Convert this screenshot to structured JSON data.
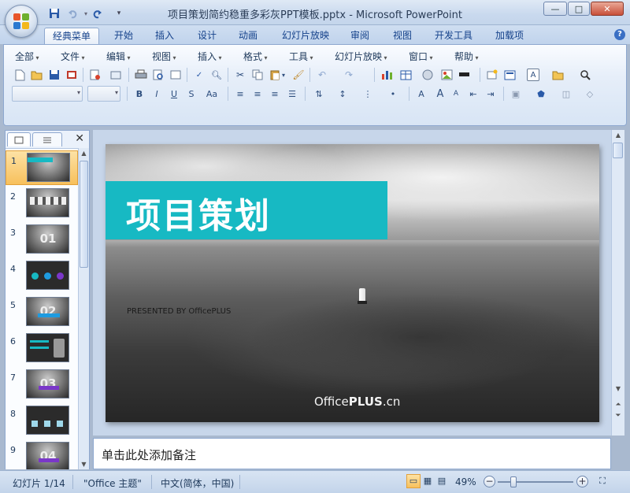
{
  "window": {
    "title": "项目策划简约稳重多彩灰PPT模板.pptx - Microsoft PowerPoint",
    "minimize": "—",
    "maximize": "□",
    "close": "✕"
  },
  "quick_access": {
    "save_icon": "save-icon",
    "undo_icon": "undo-icon",
    "redo_icon": "redo-icon",
    "customize": "▾"
  },
  "ribbon_tabs": [
    "经典菜单",
    "开始",
    "插入",
    "设计",
    "动画",
    "幻灯片放映",
    "审阅",
    "视图",
    "开发工具",
    "加载项"
  ],
  "active_tab": "经典菜单",
  "classic_menu": [
    "全部",
    "文件",
    "编辑",
    "视图",
    "插入",
    "格式",
    "工具",
    "幻灯片放映",
    "窗口",
    "帮助"
  ],
  "format_toolbar": {
    "bold": "B",
    "italic": "I",
    "underline": "U",
    "strikethrough": "S",
    "change_case": "Aa",
    "font_grow": "A",
    "font_shrink": "A",
    "font_color": "A"
  },
  "left_panel": {
    "thumbnails": [
      {
        "num": "1",
        "label": "",
        "selected": true
      },
      {
        "num": "2",
        "label": "",
        "selected": false
      },
      {
        "num": "3",
        "label": "01",
        "selected": false
      },
      {
        "num": "4",
        "label": "",
        "selected": false
      },
      {
        "num": "5",
        "label": "02",
        "selected": false
      },
      {
        "num": "6",
        "label": "",
        "selected": false
      },
      {
        "num": "7",
        "label": "03",
        "selected": false
      },
      {
        "num": "8",
        "label": "",
        "selected": false
      },
      {
        "num": "9",
        "label": "04",
        "selected": false
      }
    ],
    "close": "✕"
  },
  "slide": {
    "title": "项目策划",
    "presented": "PRESENTED BY OfficePLUS",
    "brand_light": "Office",
    "brand_bold": "PLUS",
    "brand_suffix": ".cn",
    "accent_color": "#17b9c3"
  },
  "notes": {
    "placeholder": "单击此处添加备注"
  },
  "status": {
    "slide_info": "幻灯片 1/14",
    "theme": "\"Office 主题\"",
    "language": "中文(简体，中国)",
    "zoom": "49%"
  }
}
